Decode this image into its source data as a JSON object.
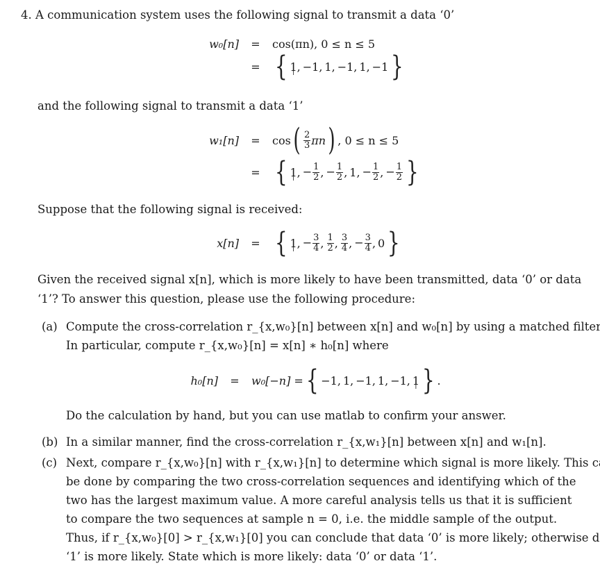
{
  "problem": {
    "number": "4.",
    "intro": "A communication system uses the following signal to transmit a data ‘0’",
    "w0": {
      "lhs": "w₀[n]",
      "def": "cos(πn), 0 ≤ n ≤ 5",
      "sequence": [
        "1",
        "−1",
        "1",
        "−1",
        "1",
        "−1"
      ],
      "origin_index": 0
    },
    "data1_intro": "and the following signal to transmit a data ‘1’",
    "w1": {
      "lhs": "w₁[n]",
      "def_func": "cos",
      "def_frac": {
        "num": "2",
        "den": "3"
      },
      "def_tail": "πn",
      "def_range": ", 0 ≤ n ≤ 5",
      "sequence": [
        {
          "sign": "",
          "num": "1",
          "den": ""
        },
        {
          "sign": "−",
          "num": "1",
          "den": "2"
        },
        {
          "sign": "−",
          "num": "1",
          "den": "2"
        },
        {
          "sign": "",
          "num": "1",
          "den": ""
        },
        {
          "sign": "−",
          "num": "1",
          "den": "2"
        },
        {
          "sign": "−",
          "num": "1",
          "den": "2"
        }
      ],
      "origin_index": 0
    },
    "received_intro": "Suppose that the following signal is received:",
    "x": {
      "lhs": "x[n]",
      "sequence": [
        {
          "sign": "",
          "num": "1",
          "den": ""
        },
        {
          "sign": "−",
          "num": "3",
          "den": "4"
        },
        {
          "sign": "",
          "num": "1",
          "den": "2"
        },
        {
          "sign": "",
          "num": "3",
          "den": "4"
        },
        {
          "sign": "−",
          "num": "3",
          "den": "4"
        },
        {
          "sign": "",
          "num": "0",
          "den": ""
        }
      ],
      "origin_index": 0
    },
    "question_line1": "Given the received signal x[n], which is more likely to have been transmitted, data ‘0’ or data",
    "question_line2": "‘1’? To answer this question, please use the following procedure:",
    "parts": {
      "a": {
        "label": "(a)",
        "line1": "Compute the cross-correlation r_{x,w₀}[n] between x[n] and w₀[n] by using a matched filter.",
        "line2": "In particular, compute r_{x,w₀}[n] = x[n] ∗ h₀[n] where",
        "h0": {
          "lhs": "h₀[n]",
          "mid": "w₀[−n] =",
          "sequence": [
            "−1",
            "1",
            "−1",
            "1",
            "−1",
            "1"
          ],
          "origin_index": 5,
          "trail": "."
        },
        "note": "Do the calculation by hand, but you can use matlab to confirm your answer."
      },
      "b": {
        "label": "(b)",
        "line1": "In a similar manner, find the cross-correlation r_{x,w₁}[n] between x[n] and w₁[n]."
      },
      "c": {
        "label": "(c)",
        "lines": [
          "Next, compare r_{x,w₀}[n] with r_{x,w₁}[n] to determine which signal is more likely. This can",
          "be done by comparing the two cross-correlation sequences and identifying which of the",
          "two has the largest maximum value. A more careful analysis tells us that it is sufficient",
          "to compare the two sequences at sample n = 0, i.e. the middle sample of the output.",
          "Thus, if r_{x,w₀}[0] > r_{x,w₁}[0] you can conclude that data ‘0’ is more likely; otherwise data",
          "‘1’ is more likely. State which is more likely: data ‘0’ or data ‘1’."
        ]
      }
    }
  }
}
